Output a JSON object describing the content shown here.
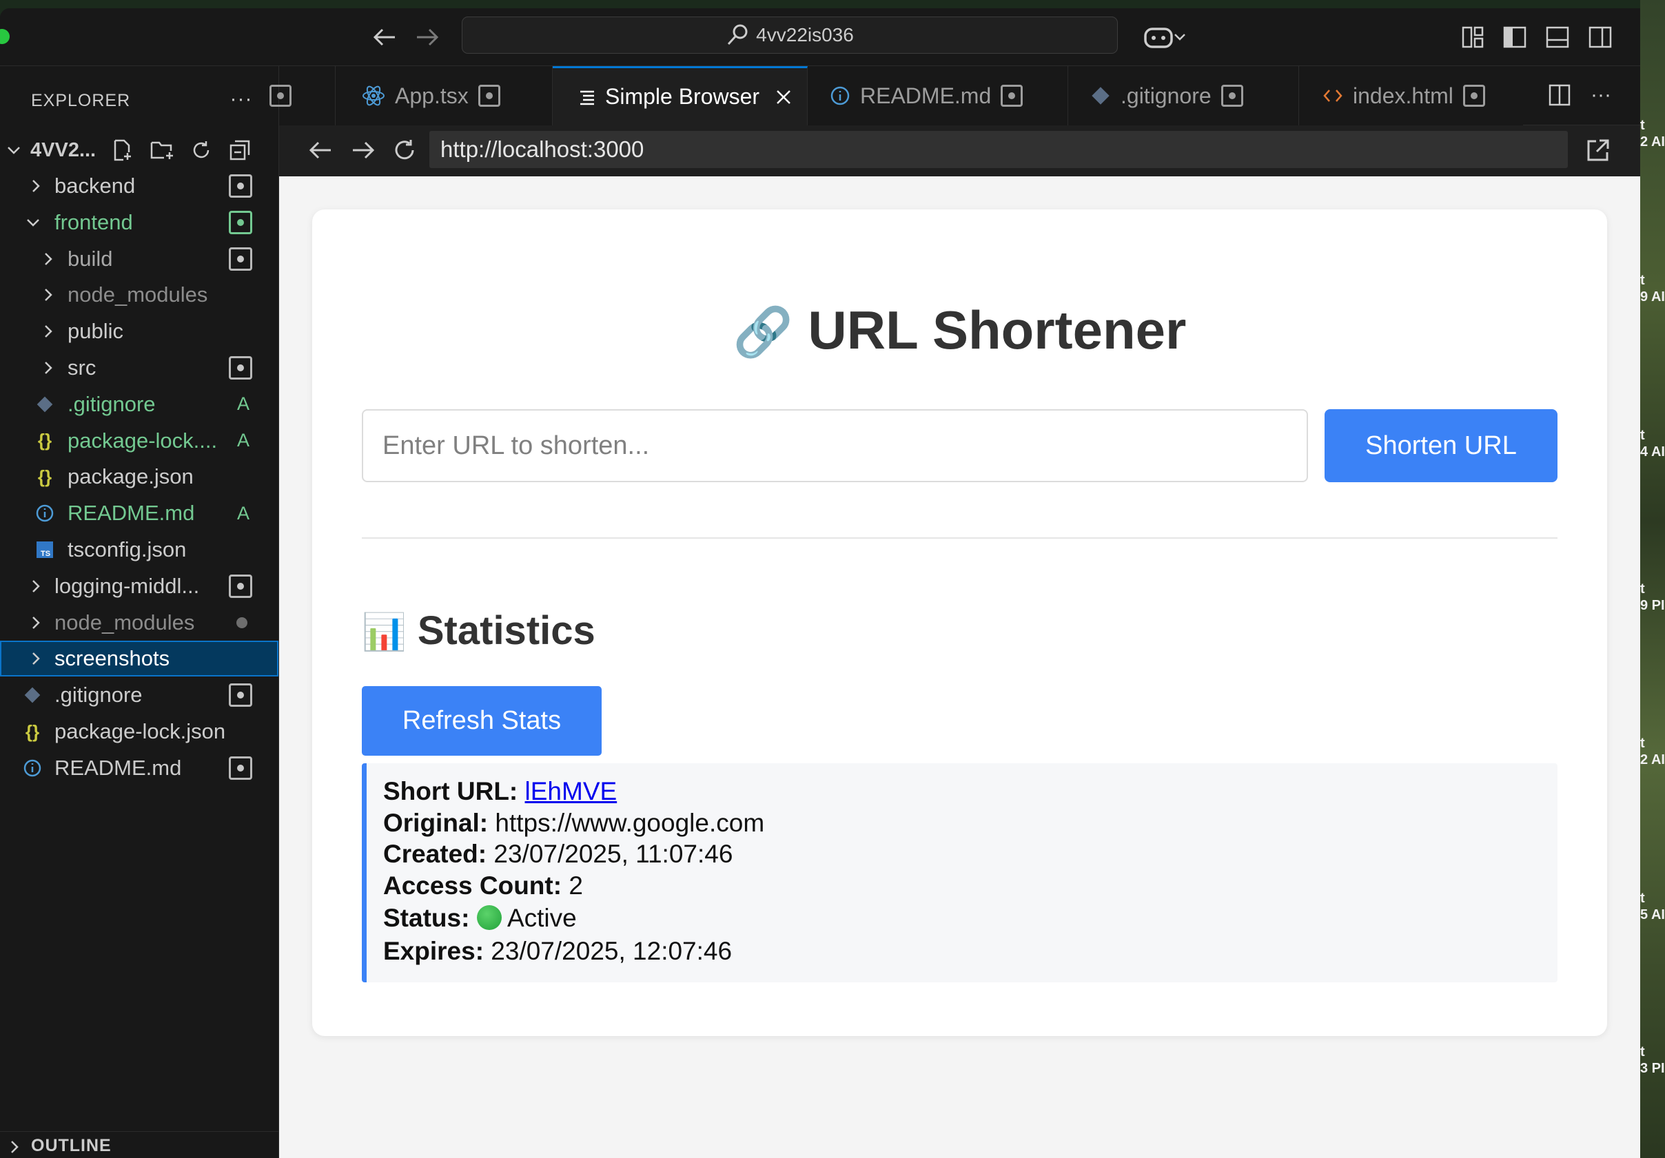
{
  "titlebar": {
    "command_center": "4vv22is036"
  },
  "sidebar": {
    "title": "EXPLORER",
    "root": "4VV2...",
    "items": [
      {
        "label": "backend",
        "kind": "folder",
        "open": false,
        "indent": 0,
        "color": "#cccccc",
        "status": "modified"
      },
      {
        "label": "frontend",
        "kind": "folder",
        "open": true,
        "indent": 0,
        "color": "#73c991",
        "status": "modified-green"
      },
      {
        "label": "build",
        "kind": "folder",
        "open": false,
        "indent": 1,
        "color": "#a8a8a8",
        "status": "modified"
      },
      {
        "label": "node_modules",
        "kind": "folder",
        "open": false,
        "indent": 1,
        "color": "#8c8c8c",
        "status": ""
      },
      {
        "label": "public",
        "kind": "folder",
        "open": false,
        "indent": 1,
        "color": "#cccccc",
        "status": ""
      },
      {
        "label": "src",
        "kind": "folder",
        "open": false,
        "indent": 1,
        "color": "#cccccc",
        "status": "modified"
      },
      {
        "label": ".gitignore",
        "kind": "git",
        "indent": 1,
        "color": "#73c991",
        "status": "A"
      },
      {
        "label": "package-lock....",
        "kind": "json",
        "indent": 1,
        "color": "#73c991",
        "status": "A"
      },
      {
        "label": "package.json",
        "kind": "json",
        "indent": 1,
        "color": "#cccccc",
        "status": ""
      },
      {
        "label": "README.md",
        "kind": "info",
        "indent": 1,
        "color": "#73c991",
        "status": "A"
      },
      {
        "label": "tsconfig.json",
        "kind": "ts",
        "indent": 1,
        "color": "#cccccc",
        "status": ""
      },
      {
        "label": "logging-middl...",
        "kind": "folder",
        "open": false,
        "indent": 0,
        "color": "#cccccc",
        "status": "modified"
      },
      {
        "label": "node_modules",
        "kind": "folder",
        "open": false,
        "indent": 0,
        "color": "#8c8c8c",
        "status": "dot"
      },
      {
        "label": "screenshots",
        "kind": "folder",
        "open": false,
        "indent": 0,
        "color": "#ffffff",
        "status": "",
        "selected": true
      },
      {
        "label": ".gitignore",
        "kind": "git",
        "indent": 0,
        "color": "#cccccc",
        "status": "modified"
      },
      {
        "label": "package-lock.json",
        "kind": "json",
        "indent": 0,
        "color": "#cccccc",
        "status": ""
      },
      {
        "label": "README.md",
        "kind": "info",
        "indent": 0,
        "color": "#cccccc",
        "status": "modified"
      }
    ],
    "outline": "OUTLINE"
  },
  "tabs": [
    {
      "label": "App.tsx"
    },
    {
      "label": "Simple Browser",
      "active": true
    },
    {
      "label": "README.md"
    },
    {
      "label": ".gitignore"
    },
    {
      "label": "index.html"
    }
  ],
  "browser": {
    "url": "http://localhost:3000"
  },
  "app": {
    "title_emoji": "🔗",
    "title": "URL Shortener",
    "input_placeholder": "Enter URL to shorten...",
    "shorten_button": "Shorten URL",
    "stats_emoji": "📊",
    "stats_title": "Statistics",
    "refresh_button": "Refresh Stats",
    "stat": {
      "short_url_label": "Short URL:",
      "short_url_value": "lEhMVE",
      "original_label": "Original:",
      "original_value": "https://www.google.com",
      "created_label": "Created:",
      "created_value": "23/07/2025, 11:07:46",
      "count_label": "Access Count:",
      "count_value": "2",
      "status_label": "Status:",
      "status_value": "Active",
      "expires_label": "Expires:",
      "expires_value": "23/07/2025, 12:07:46"
    }
  },
  "desktop_fragments": [
    "t\n2 AI",
    "t\n9 AI",
    "t\n4 AI",
    "t\n9 PI",
    "t\n2 AI",
    "t\n5 AI",
    "t\n3 PI"
  ],
  "colors": {
    "accent": "#3b82f6",
    "git_added": "#73c991",
    "vscode_bg": "#181818",
    "selection": "#04395e"
  }
}
